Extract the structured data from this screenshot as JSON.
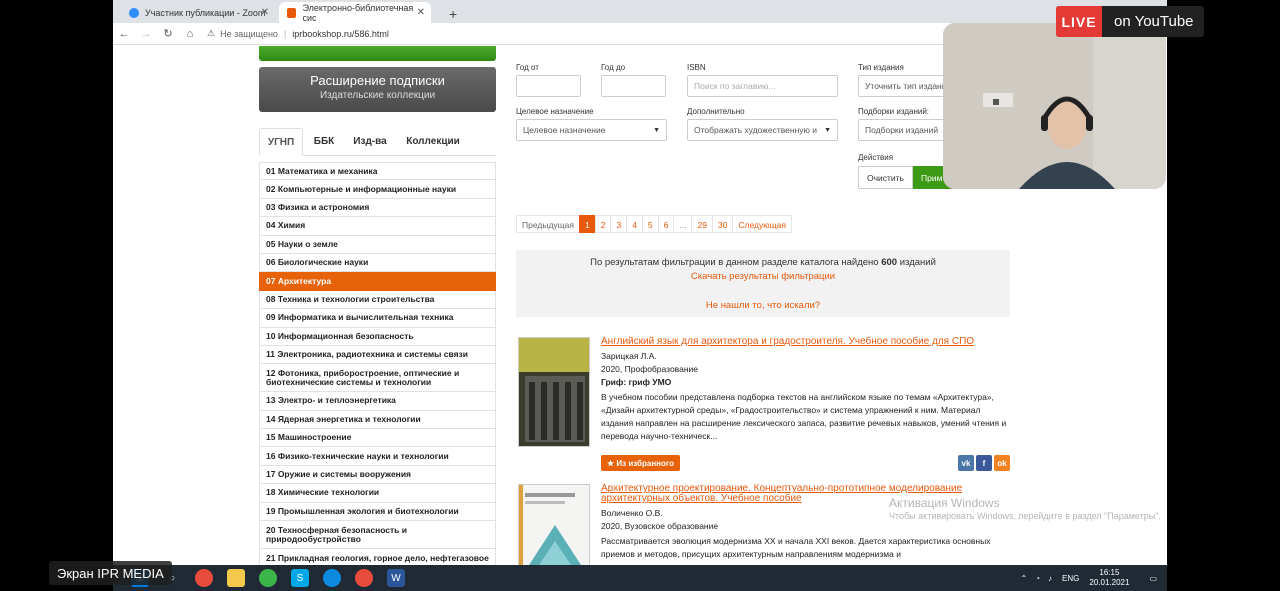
{
  "browser": {
    "tabs": [
      {
        "label": "Участник публикации - Zoom"
      },
      {
        "label": "Электронно-библиотечная сис"
      }
    ],
    "new_tab": "+",
    "secure_label": "Не защищено",
    "url": "iprbookshop.ru/586.html"
  },
  "subscription": {
    "title": "Расширение подписки",
    "subtitle": "Издательские коллекции"
  },
  "category_tabs": [
    "УГНП",
    "ББК",
    "Изд-ва",
    "Коллекции"
  ],
  "categories": [
    "01 Математика и механика",
    "02 Компьютерные и информационные науки",
    "03 Физика и астрономия",
    "04 Химия",
    "05 Науки о земле",
    "06 Биологические науки",
    "07 Архитектура",
    "08 Техника и технологии строительства",
    "09 Информатика и вычислительная техника",
    "10 Информационная безопасность",
    "11 Электроника, радиотехника и системы связи",
    "12 Фотоника, приборостроение, оптические и биотехнические системы и технологии",
    "13 Электро- и теплоэнергетика",
    "14 Ядерная энергетика и технологии",
    "15 Машиностроение",
    "16 Физико-технические науки и технологии",
    "17 Оружие и системы вооружения",
    "18 Химические технологии",
    "19 Промышленная экология и биотехнологии",
    "20 Техносферная безопасность и природообустройство",
    "21 Прикладная геология, горное дело, нефтегазовое дело и геодезия"
  ],
  "filters": {
    "year_from_label": "Год от",
    "year_to_label": "Год до",
    "isbn_label": "ISBN",
    "isbn_placeholder": "Поиск по заглавию...",
    "pubtype_label": "Тип издания",
    "pubtype_value": "Уточнить тип издания",
    "purpose_label": "Целевое назначение",
    "purpose_value": "Целевое назначение",
    "extra_label": "Дополнительно",
    "extra_value": "Отображать художественную и",
    "collections_label": "Подборки изданий:",
    "collections_value": "Подборки изданий",
    "actions_label": "Действия",
    "clear_label": "Очистить",
    "apply_label": "Прим"
  },
  "pagination": {
    "prev": "Предыдущая",
    "pages": [
      "1",
      "2",
      "3",
      "4",
      "5",
      "6",
      "...",
      "29",
      "30"
    ],
    "next": "Следующая"
  },
  "results": {
    "prefix": "По результатам фильтрации в данном разделе каталога найдено",
    "count": "600",
    "suffix": "изданий",
    "download": "Скачать результаты фильтрации",
    "notfound": "Не нашли то, что искали?"
  },
  "books": [
    {
      "title": "Английский язык для архитектора и градостроителя. Учебное пособие для СПО",
      "author": "Зарицкая Л.А.",
      "publisher": "2020, Профобразование",
      "grif": "Гриф: гриф УМО",
      "description": "В учебном пособии представлена подборка текстов на английском языке по темам «Архитектура», «Дизайн архитектурной среды», «Градостроительство» и система упражнений к ним. Материал издания направлен на расширение лексического запаса, развитие речевых навыков, умений чтения и перевода научно-техническ...",
      "fav": "Из избранного"
    },
    {
      "title": "Архитектурное проектирование. Концептуально-прототипное моделирование архитектурных объектов. Учебное пособие",
      "author": "Воличенко О.В.",
      "publisher": "2020, Вузовское образование",
      "description": "Рассматривается эволюция модернизма XX и начала XXI веков. Дается характеристика основных приемов и методов, присущих архитектурным направлениям модернизма и"
    }
  ],
  "social": [
    "vk-icon",
    "facebook-icon",
    "odnoklassniki-icon"
  ],
  "windows": {
    "activation_title": "Активация Windows",
    "activation_sub": "Чтобы активировать Windows, перейдите в раздел \"Параметры\"."
  },
  "taskbar": {
    "lang": "ENG",
    "time": "16:15",
    "date": "20.01.2021"
  },
  "overlay": {
    "live": "LIVE",
    "live_text": "on YouTube",
    "screen_label": "Экран IPR MEDIA"
  },
  "colors": {
    "accent": "#e8590c",
    "green": "#3c9a14"
  }
}
